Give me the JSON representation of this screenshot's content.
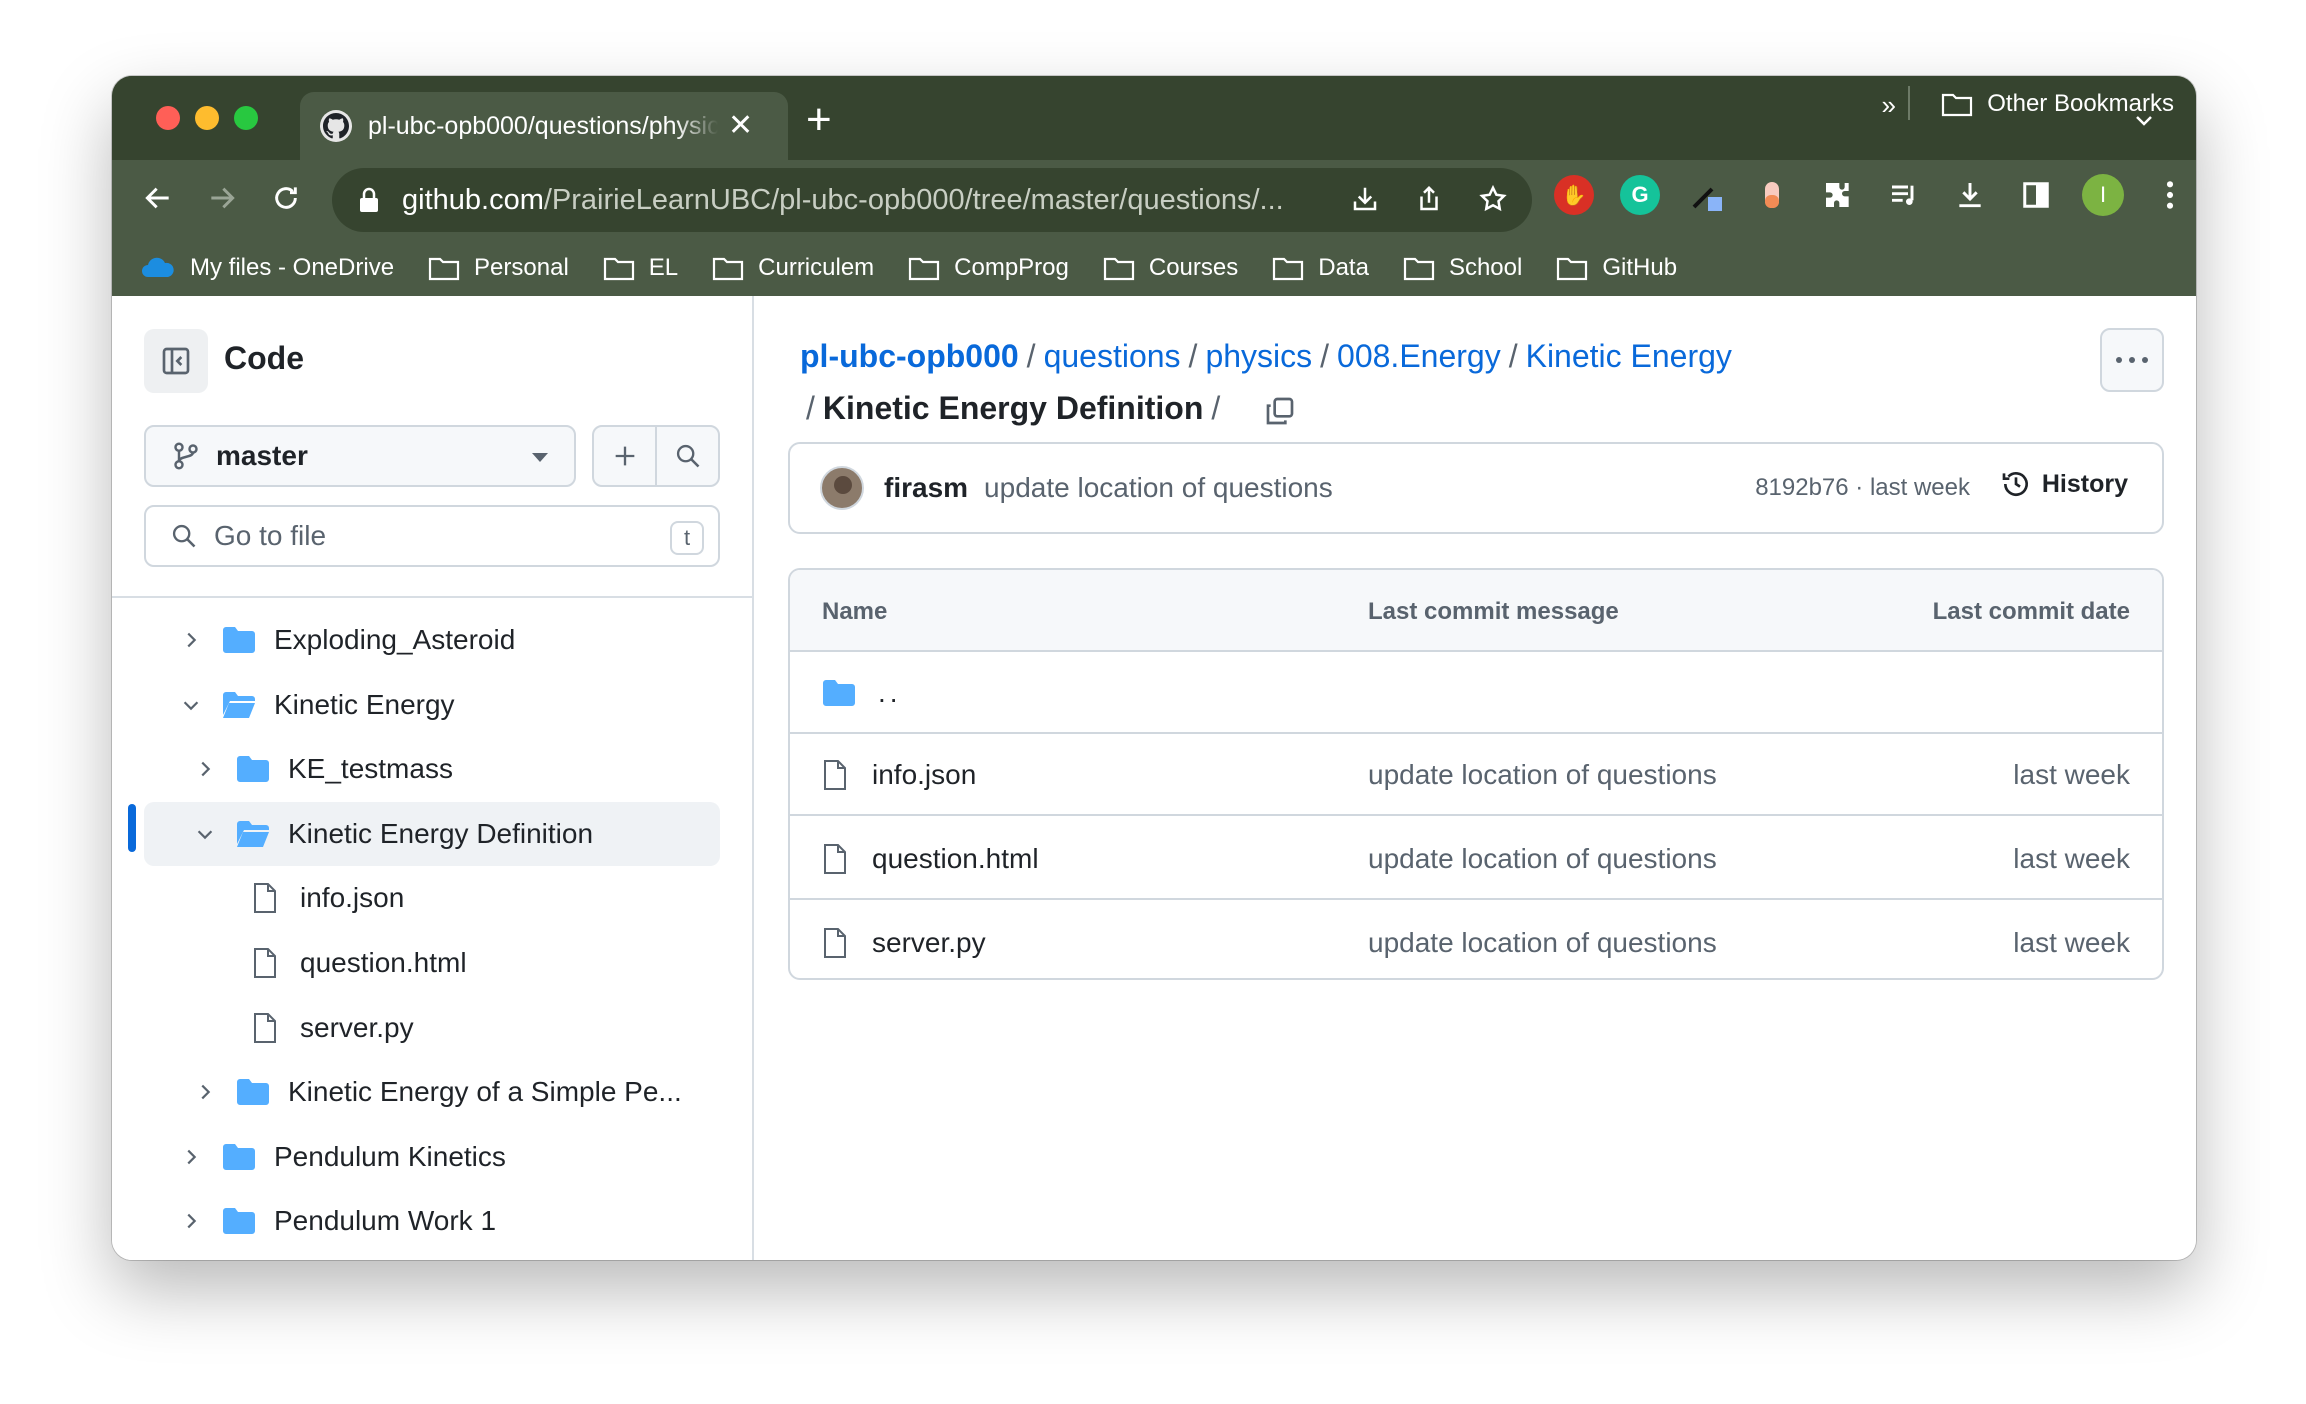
{
  "browser": {
    "tab_title": "pl-ubc-opb000/questions/physics",
    "url_host": "github.com",
    "url_path": "/PrairieLearnUBC/pl-ubc-opb000/tree/master/questions/...",
    "profile_initial": "I",
    "bookmarks": [
      {
        "label": "My files - OneDrive",
        "icon": "onedrive-icon"
      },
      {
        "label": "Personal",
        "icon": "folder-icon"
      },
      {
        "label": "EL",
        "icon": "folder-icon"
      },
      {
        "label": "Curriculem",
        "icon": "folder-icon"
      },
      {
        "label": "CompProg",
        "icon": "folder-icon"
      },
      {
        "label": "Courses",
        "icon": "folder-icon"
      },
      {
        "label": "Data",
        "icon": "folder-icon"
      },
      {
        "label": "School",
        "icon": "folder-icon"
      },
      {
        "label": "GitHub",
        "icon": "folder-icon"
      }
    ],
    "bookmarks_overflow": "»",
    "other_bookmarks": "Other Bookmarks"
  },
  "sidebar": {
    "title": "Code",
    "branch": "master",
    "goto_placeholder": "Go to file",
    "goto_shortcut": "t",
    "tree": [
      {
        "label": "Exploding_Asteroid",
        "type": "folder",
        "expanded": false
      },
      {
        "label": "Kinetic Energy",
        "type": "folder",
        "expanded": true
      },
      {
        "label": "KE_testmass",
        "type": "folder",
        "expanded": false
      },
      {
        "label": "Kinetic Energy Definition",
        "type": "folder",
        "expanded": true,
        "active": true
      },
      {
        "label": "info.json",
        "type": "file"
      },
      {
        "label": "question.html",
        "type": "file"
      },
      {
        "label": "server.py",
        "type": "file"
      },
      {
        "label": "Kinetic Energy of a Simple Pe...",
        "type": "folder",
        "expanded": false
      },
      {
        "label": "Pendulum Kinetics",
        "type": "folder",
        "expanded": false
      },
      {
        "label": "Pendulum Work 1",
        "type": "folder",
        "expanded": false
      }
    ]
  },
  "breadcrumb": {
    "repo": "pl-ubc-opb000",
    "parts": [
      "questions",
      "physics",
      "008.Energy",
      "Kinetic Energy"
    ],
    "current": "Kinetic Energy Definition",
    "separator": "/"
  },
  "commit": {
    "author": "firasm",
    "message": "update location of questions",
    "meta": "8192b76 · last week",
    "history_label": "History"
  },
  "file_table": {
    "headers": {
      "name": "Name",
      "message": "Last commit message",
      "date": "Last commit date"
    },
    "parent": "..",
    "rows": [
      {
        "name": "info.json",
        "message": "update location of questions",
        "date": "last week"
      },
      {
        "name": "question.html",
        "message": "update location of questions",
        "date": "last week"
      },
      {
        "name": "server.py",
        "message": "update location of questions",
        "date": "last week"
      }
    ]
  },
  "colors": {
    "chrome_frame": "#36442f",
    "chrome_toolbar": "#4b5a45",
    "link": "#0969da",
    "folder": "#54aeff",
    "active_bar": "#0969da"
  }
}
